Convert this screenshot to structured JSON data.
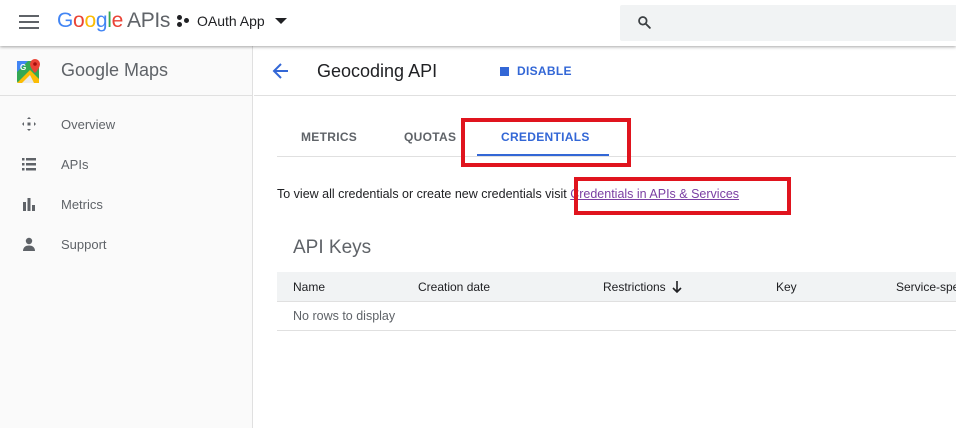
{
  "topbar": {
    "logo_google": "Google",
    "logo_apis": "APIs",
    "project_name": "OAuth App"
  },
  "sidebar": {
    "product_title": "Google Maps",
    "items": [
      {
        "label": "Overview",
        "icon": "overview-icon"
      },
      {
        "label": "APIs",
        "icon": "list-icon"
      },
      {
        "label": "Metrics",
        "icon": "bar-chart-icon"
      },
      {
        "label": "Support",
        "icon": "person-icon"
      }
    ]
  },
  "main": {
    "api_title": "Geocoding API",
    "disable_label": "DISABLE",
    "tabs": [
      {
        "label": "METRICS",
        "active": false
      },
      {
        "label": "QUOTAS",
        "active": false
      },
      {
        "label": "CREDENTIALS",
        "active": true
      }
    ],
    "info_text": "To view all credentials or create new credentials visit",
    "info_link": "Credentials in APIs & Services",
    "section_title": "API Keys",
    "table": {
      "columns": [
        "Name",
        "Creation date",
        "Restrictions",
        "Key",
        "Service-specific"
      ],
      "empty_text": "No rows to display"
    }
  },
  "colors": {
    "accent": "#3367d6",
    "highlight": "#e0141e",
    "link_visited": "#7b3fa3"
  }
}
